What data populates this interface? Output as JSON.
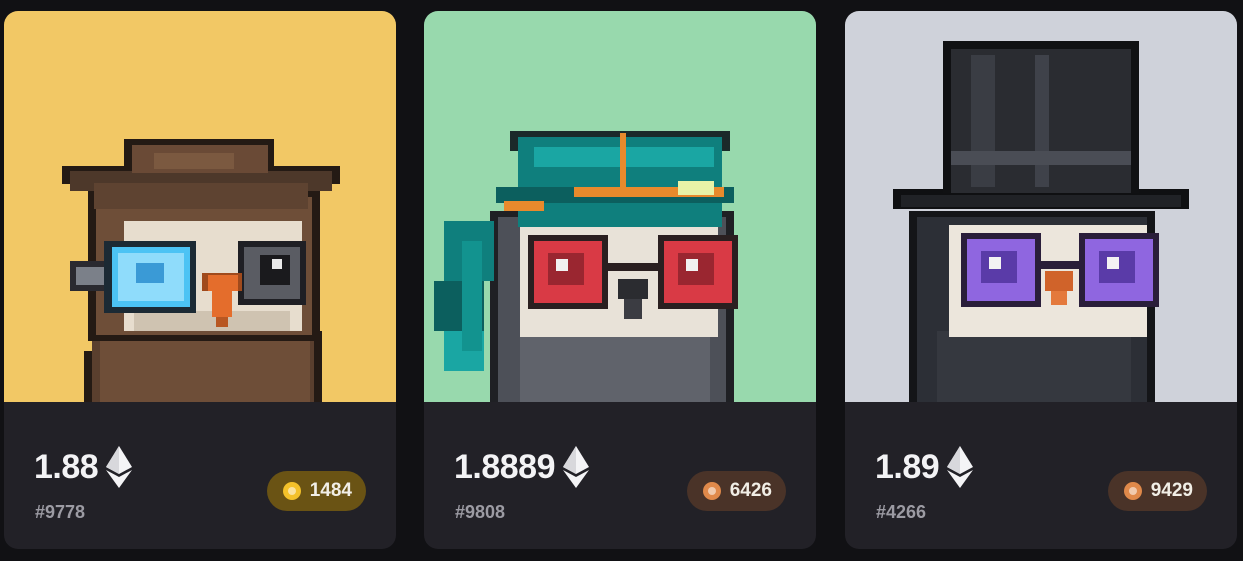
{
  "cards": [
    {
      "price": "1.88",
      "currency_icon": "ethereum-icon",
      "token_id": "#9778",
      "rank": "1484",
      "rank_tier": "gold",
      "rank_icon": "medal-icon",
      "background_color": "#f2c865",
      "character": "brown owl with monocle and brown pointed hat"
    },
    {
      "price": "1.8889",
      "currency_icon": "ethereum-icon",
      "token_id": "#9808",
      "rank": "6426",
      "rank_tier": "bronze",
      "rank_icon": "medal-icon",
      "background_color": "#98d9ad",
      "character": "grey owl with red glasses and teal bandana"
    },
    {
      "price": "1.89",
      "currency_icon": "ethereum-icon",
      "token_id": "#4266",
      "rank": "9429",
      "rank_tier": "bronze",
      "rank_icon": "medal-icon",
      "background_color": "#cfd2da",
      "character": "dark owl with purple glasses and black top hat"
    }
  ],
  "colors": {
    "page_background": "#111114",
    "card_info_background": "#222127",
    "rank_gold": "#f3c12a",
    "rank_bronze": "#e0894a"
  }
}
